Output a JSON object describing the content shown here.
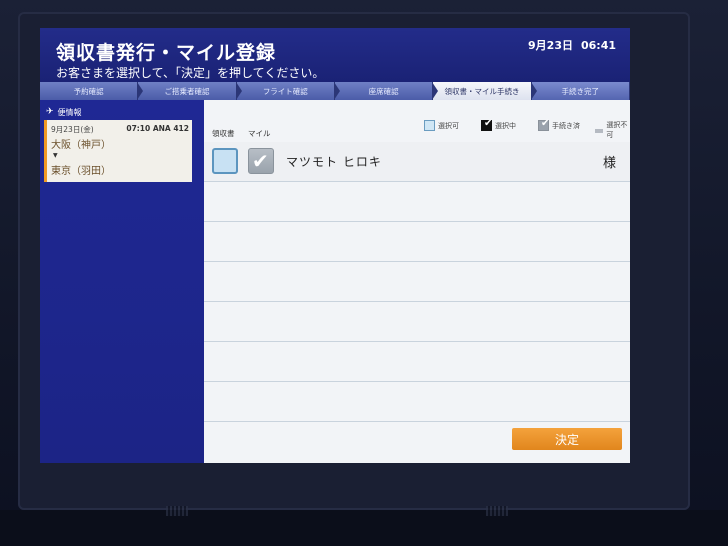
{
  "header": {
    "title": "領収書発行・マイル登録",
    "subtitle": "お客さまを選択して、「決定」を押してください。",
    "date": "9月23日",
    "time": "06:41"
  },
  "steps": [
    {
      "label": "予約確認",
      "active": false
    },
    {
      "label": "ご搭乗者確認",
      "active": false
    },
    {
      "label": "フライト確認",
      "active": false
    },
    {
      "label": "座席確認",
      "active": false
    },
    {
      "label": "領収書・マイル手続き",
      "active": true
    },
    {
      "label": "手続き完了",
      "active": false
    }
  ],
  "sidebar": {
    "heading": "便情報",
    "flight": {
      "date": "9月23日(金)",
      "time_flight": "07:10 ANA 412",
      "from": "大阪（神戸）",
      "arrow": "▼",
      "to": "東京（羽田）"
    }
  },
  "main": {
    "columns": {
      "receipt": "領収書",
      "mile": "マイル"
    },
    "legend": {
      "selectable": "選択可",
      "selected": "選択中",
      "done": "手続き済",
      "unselectable": "選択不可"
    },
    "passengers": [
      {
        "name": "マツモト ヒロキ",
        "suffix": "様",
        "receipt_selected": false,
        "mile_state": "selected"
      }
    ],
    "confirm_label": "決定"
  },
  "colors": {
    "header_bg": "#1a2275",
    "sidebar_bg": "#1f2894",
    "accent_orange": "#e1861d",
    "step_active": "#f6f7fb"
  }
}
